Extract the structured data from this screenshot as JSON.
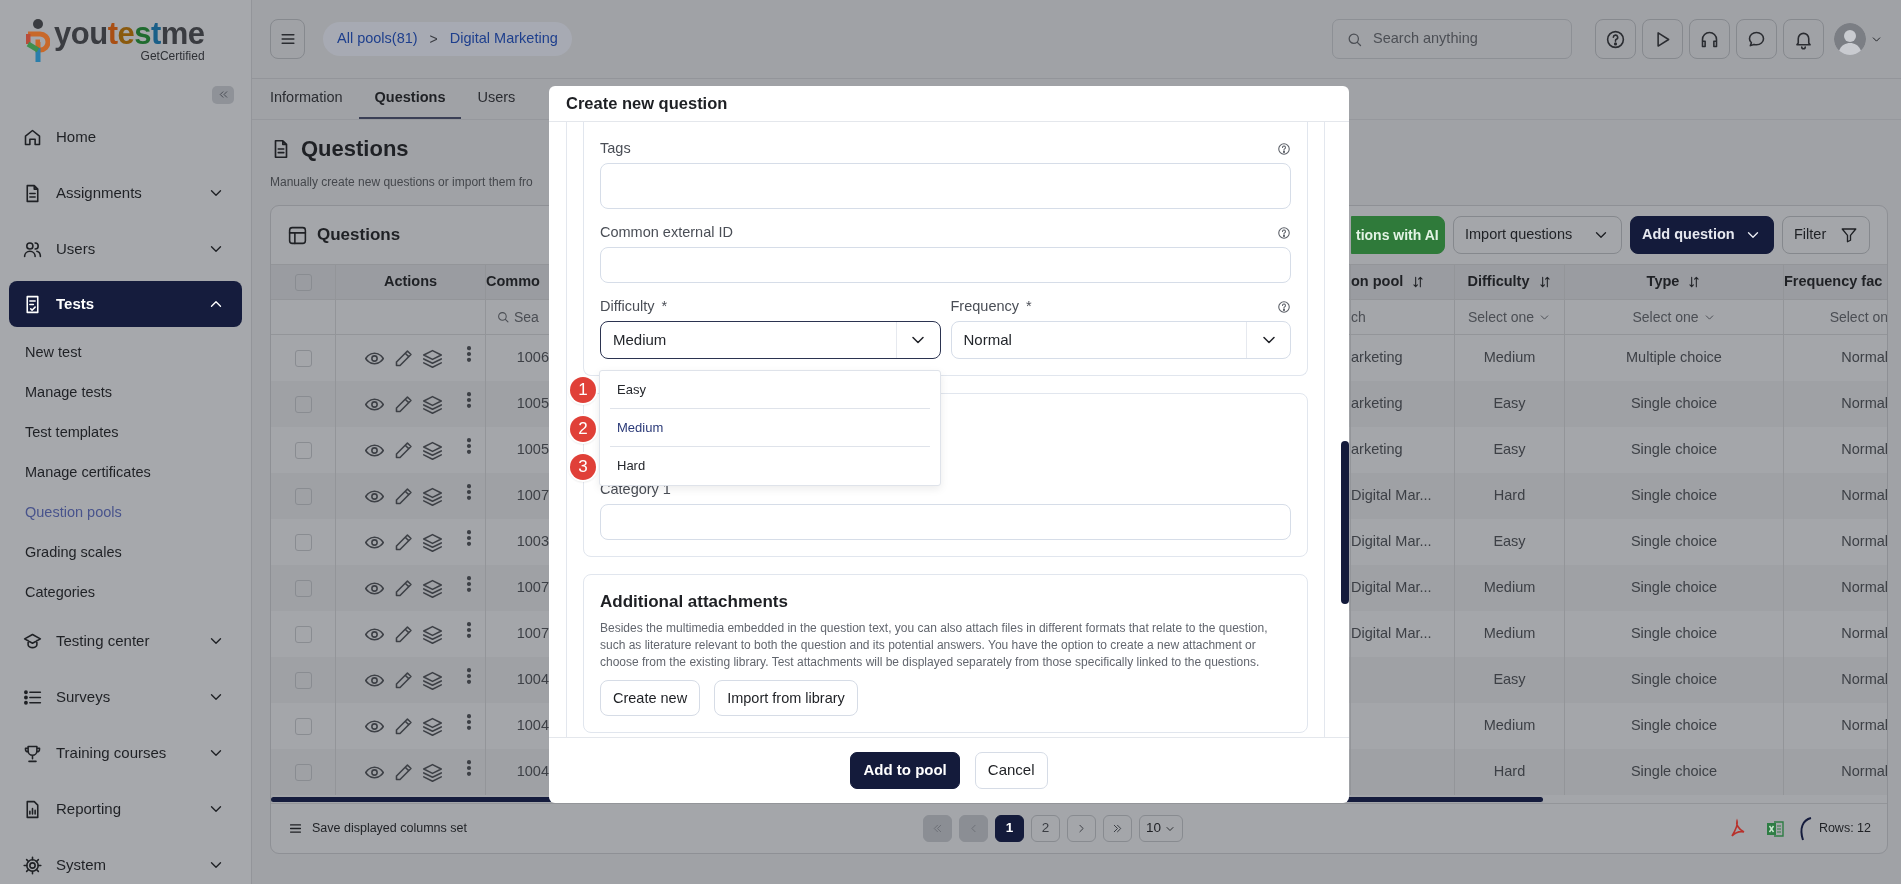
{
  "sidebar": {
    "logo": {
      "parts": [
        {
          "text": "you",
          "color": "#3a3c41"
        },
        {
          "text": "t",
          "color": "#a94f14"
        },
        {
          "text": "e",
          "color": "#8a5a0e"
        },
        {
          "text": "s",
          "color": "#1f6b2e"
        },
        {
          "text": "t",
          "color": "#1a5f88"
        },
        {
          "text": "me",
          "color": "#3a3c41"
        }
      ],
      "tagline": "GetCertified"
    },
    "items": [
      {
        "label": "Home",
        "kind": "link",
        "selected": false
      },
      {
        "label": "Assignments",
        "kind": "group",
        "selected": false,
        "expanded": false
      },
      {
        "label": "Users",
        "kind": "group",
        "selected": false,
        "expanded": false
      },
      {
        "label": "Tests",
        "kind": "group",
        "selected": true,
        "expanded": true,
        "children": [
          {
            "label": "New test",
            "selected": false
          },
          {
            "label": "Manage tests",
            "selected": false
          },
          {
            "label": "Test templates",
            "selected": false
          },
          {
            "label": "Manage certificates",
            "selected": false
          },
          {
            "label": "Question pools",
            "selected": true
          },
          {
            "label": "Grading scales",
            "selected": false
          },
          {
            "label": "Categories",
            "selected": false
          }
        ]
      },
      {
        "label": "Testing center",
        "kind": "group",
        "selected": false,
        "expanded": false
      },
      {
        "label": "Surveys",
        "kind": "group",
        "selected": false,
        "expanded": false
      },
      {
        "label": "Training courses",
        "kind": "group",
        "selected": false,
        "expanded": false
      },
      {
        "label": "Reporting",
        "kind": "group",
        "selected": false,
        "expanded": false
      },
      {
        "label": "System",
        "kind": "group",
        "selected": false,
        "expanded": false
      }
    ]
  },
  "topbar": {
    "breadcrumb": [
      {
        "label": "All pools(81)"
      },
      {
        "label": "Digital Marketing"
      }
    ],
    "separator": ">",
    "search": {
      "placeholder": "Search anything"
    }
  },
  "tabs": [
    {
      "label": "Information",
      "selected": false
    },
    {
      "label": "Questions",
      "selected": true
    },
    {
      "label": "Users",
      "selected": false
    }
  ],
  "page": {
    "title": "Questions",
    "subtitle": "Manually create new questions or import them fro"
  },
  "card": {
    "title": "Questions",
    "buttons": [
      {
        "label": "tions with AI",
        "kind": "ai"
      },
      {
        "label": "Import questions",
        "kind": "dropdown"
      },
      {
        "label": "Add question",
        "kind": "primary-dropdown"
      },
      {
        "label": "Filter",
        "kind": "filter"
      }
    ],
    "table": {
      "all_checked": false,
      "columns": [
        {
          "label": "Actions"
        },
        {
          "label": "Commo"
        },
        {
          "label": "on pool",
          "sortable": true
        },
        {
          "label": "Difficulty",
          "sortable": true
        },
        {
          "label": "Type",
          "sortable": true
        },
        {
          "label": "Frequency fac"
        }
      ],
      "filters": {
        "common": "Sea",
        "pool": "ch",
        "difficulty": "Select one",
        "type": "Select one",
        "frequency": "Select on"
      },
      "rows": [
        {
          "checked": false,
          "id": "1006",
          "pool": "arketing",
          "difficulty": "Medium",
          "type": "Multiple choice",
          "frequency": "Normal"
        },
        {
          "checked": false,
          "id": "1005",
          "pool": "arketing",
          "difficulty": "Easy",
          "type": "Single choice",
          "frequency": "Normal"
        },
        {
          "checked": false,
          "id": "1005",
          "pool": "arketing",
          "difficulty": "Easy",
          "type": "Single choice",
          "frequency": "Normal"
        },
        {
          "checked": false,
          "id": "1007",
          "pool": "Digital Mar...",
          "difficulty": "Hard",
          "type": "Single choice",
          "frequency": "Normal"
        },
        {
          "checked": false,
          "id": "1003",
          "pool": "Digital Mar...",
          "difficulty": "Easy",
          "type": "Single choice",
          "frequency": "Normal"
        },
        {
          "checked": false,
          "id": "1007",
          "pool": "Digital Mar...",
          "difficulty": "Medium",
          "type": "Single choice",
          "frequency": "Normal"
        },
        {
          "checked": false,
          "id": "1007",
          "pool": "Digital Mar...",
          "difficulty": "Medium",
          "type": "Single choice",
          "frequency": "Normal"
        },
        {
          "checked": false,
          "id": "1004",
          "difficulty": "Easy",
          "type": "Single choice",
          "frequency": "Normal"
        },
        {
          "checked": false,
          "id": "1004",
          "difficulty": "Medium",
          "type": "Single choice",
          "frequency": "Normal"
        },
        {
          "checked": false,
          "id": "1004",
          "difficulty": "Hard",
          "type": "Single choice",
          "frequency": "Normal"
        }
      ]
    },
    "footer": {
      "columns_label": "Save displayed columns set",
      "first_disabled": true,
      "prev_disabled": true,
      "next_disabled": false,
      "last_disabled": false,
      "pages": [
        {
          "label": "1",
          "selected": true
        },
        {
          "label": "2",
          "selected": false
        }
      ],
      "page_size": "10",
      "rows": "Rows: 12"
    }
  },
  "modal": {
    "title": "Create new question",
    "tags": {
      "label": "Tags"
    },
    "external_id": {
      "label": "Common external ID"
    },
    "difficulty": {
      "label": "Difficulty",
      "required_mark": "*",
      "value": "Medium",
      "focused": true
    },
    "frequency": {
      "label": "Frequency",
      "required_mark": "*",
      "value": "Normal",
      "focused": false
    },
    "dropdown": {
      "options": [
        {
          "label": "Easy",
          "selected": false
        },
        {
          "label": "Medium",
          "selected": true
        },
        {
          "label": "Hard",
          "selected": false
        }
      ],
      "markers": [
        "1",
        "2",
        "3"
      ]
    },
    "category": {
      "label": "Category 1"
    },
    "attachments": {
      "title": "Additional attachments",
      "text": "Besides the multimedia embedded in the question text, you can also attach files in different formats that relate to the question, such as literature relevant to both the question and its potential answers. You have the option to create a new attachment or choose from the existing library. Test attachments will be displayed separately from those specifically linked to the questions.",
      "buttons": [
        "Create new",
        "Import from library"
      ]
    },
    "buttons": [
      {
        "label": "Add to pool",
        "kind": "primary"
      },
      {
        "label": "Cancel",
        "kind": "secondary"
      }
    ]
  }
}
